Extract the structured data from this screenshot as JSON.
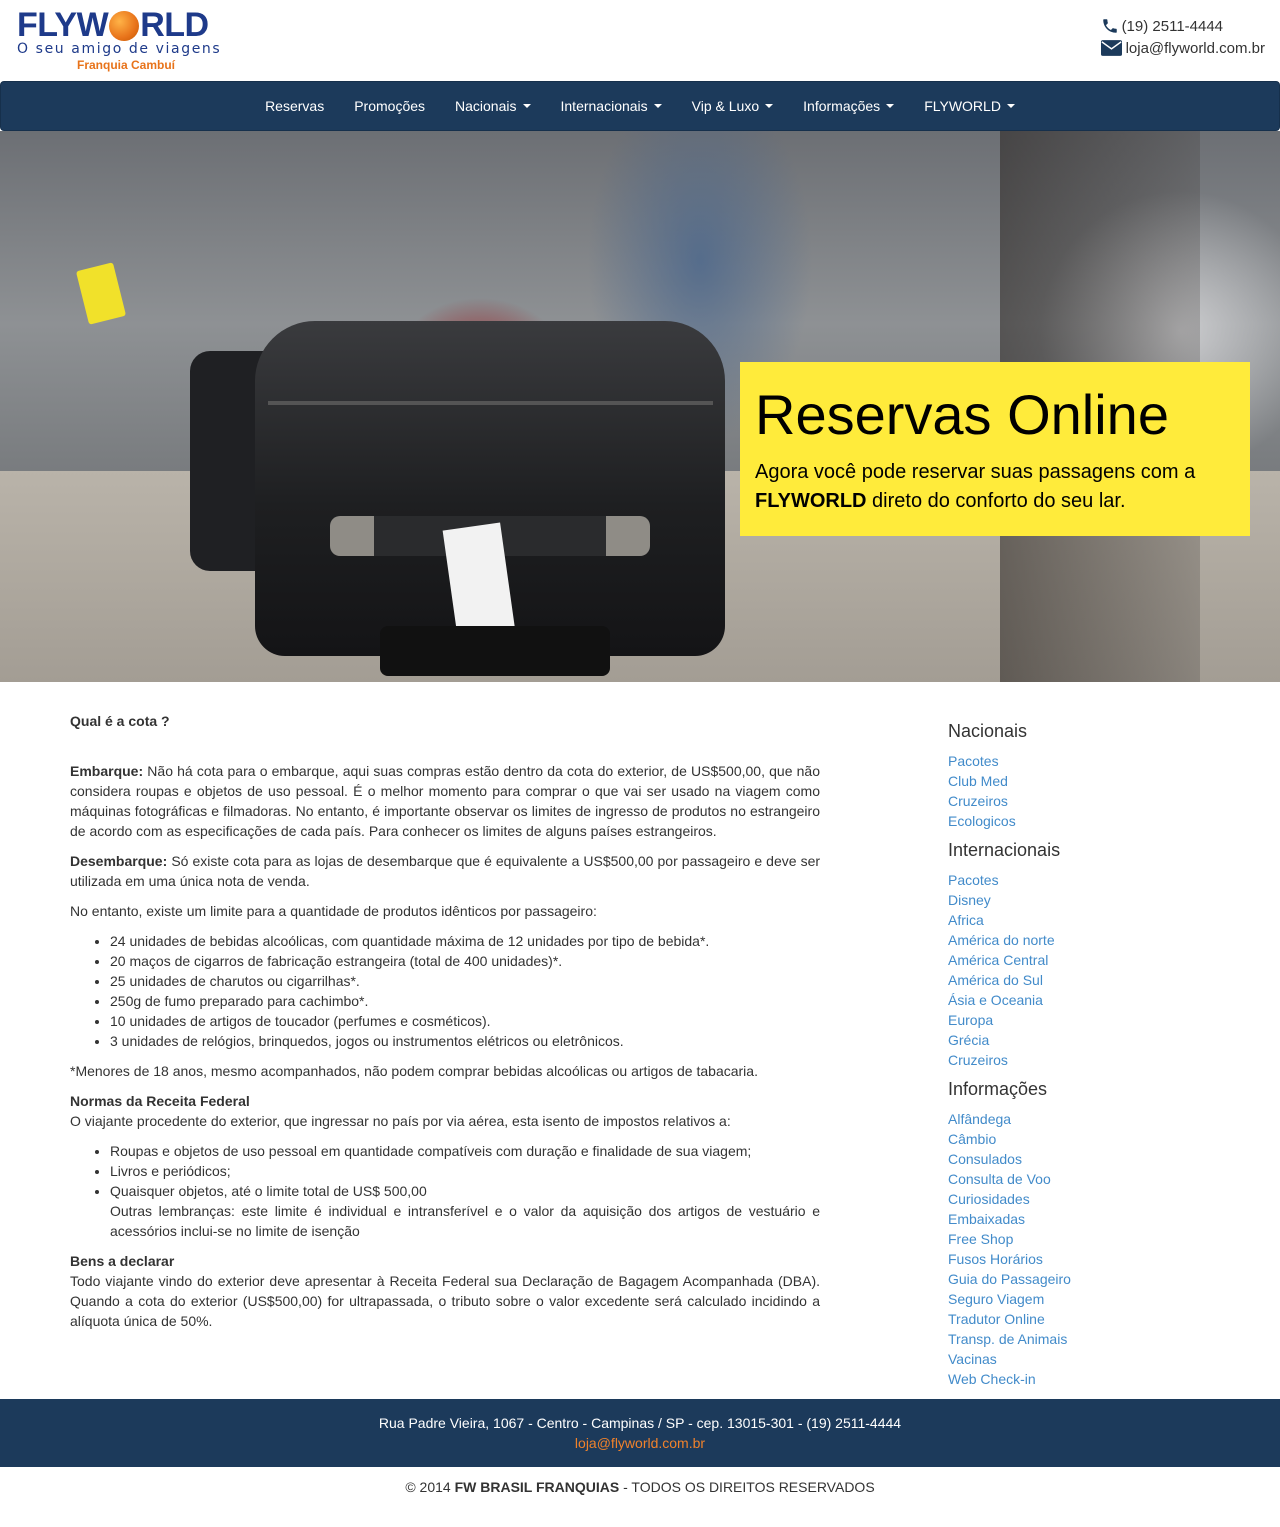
{
  "header": {
    "logo_name": "FLYWORLD",
    "logo_prefix": "FLYW",
    "logo_suffix": "RLD",
    "logo_tagline": "O seu amigo de viagens",
    "logo_franchise": "Franquia Cambuí",
    "phone": "(19) 2511-4444",
    "email": "loja@flyworld.com.br",
    "icons": {
      "phone": "phone-icon",
      "email": "envelope-icon"
    }
  },
  "nav": {
    "items": [
      {
        "label": "Reservas",
        "dropdown": false
      },
      {
        "label": "Promoções",
        "dropdown": false
      },
      {
        "label": "Nacionais",
        "dropdown": true
      },
      {
        "label": "Internacionais",
        "dropdown": true
      },
      {
        "label": "Vip & Luxo",
        "dropdown": true
      },
      {
        "label": "Informações",
        "dropdown": true
      },
      {
        "label": "FLYWORLD",
        "dropdown": true
      }
    ]
  },
  "hero": {
    "title": "Reservas Online",
    "text_before": "Agora você pode reservar suas passagens com a",
    "text_brand": "FLYWORLD",
    "text_after": "direto do conforto do seu lar."
  },
  "content": {
    "heading": "Qual é a cota ?",
    "embarque_label": "Embarque:",
    "embarque_text": "Não há cota para o embarque, aqui suas compras estão dentro da cota do exterior, de US$500,00, que não considera roupas e objetos de uso pessoal. É o melhor momento para comprar o que vai ser usado na viagem como máquinas fotográficas e filmadoras. No entanto, é importante observar os limites de ingresso de produtos no estrangeiro de acordo com as especificações de cada país. Para conhecer os limites de alguns países estrangeiros.",
    "desembarque_label": "Desembarque:",
    "desembarque_text": "Só existe cota para as lojas de desembarque que é equivalente a US$500,00 por passageiro e deve ser utilizada em uma única nota de venda.",
    "limit_intro": "No entanto, existe um limite para a quantidade de produtos idênticos por passageiro:",
    "limits": [
      "24 unidades de bebidas alcoólicas, com quantidade máxima de 12 unidades por tipo de bebida*.",
      "20 maços de cigarros de fabricação estrangeira (total de 400 unidades)*.",
      "25 unidades de charutos ou cigarrilhas*.",
      "250g de fumo preparado para cachimbo*.",
      "10 unidades de artigos de toucador (perfumes e cosméticos).",
      "3 unidades de relógios, brinquedos, jogos ou instrumentos elétricos ou eletrônicos."
    ],
    "minors_note": "*Menores de 18 anos, mesmo acompanhados, não podem comprar bebidas alcoólicas ou artigos de tabacaria.",
    "normas_heading": "Normas da Receita Federal",
    "normas_text": "O viajante procedente do exterior, que ingressar no país por via aérea, esta isento de impostos relativos a:",
    "normas_items": [
      "Roupas e objetos de uso pessoal em quantidade compatíveis com duração e finalidade de sua viagem;",
      "Livros e periódicos;",
      "Quaisquer objetos, até o limite total de US$ 500,00"
    ],
    "normas_extra": "Outras lembranças: este limite é individual e intransferível e o valor da aquisição dos artigos de vestuário e acessórios inclui-se no limite de isenção",
    "bens_heading": "Bens a declarar",
    "bens_text": "Todo viajante vindo do exterior deve apresentar à Receita Federal sua Declaração de Bagagem Acompanhada (DBA). Quando a cota do exterior (US$500,00) for ultrapassada, o tributo sobre o valor excedente será calculado incidindo a alíquota única de 50%."
  },
  "sidebar": {
    "nacionais": {
      "title": "Nacionais",
      "links": [
        "Pacotes",
        "Club Med",
        "Cruzeiros",
        "Ecologicos"
      ]
    },
    "internacionais": {
      "title": "Internacionais",
      "links": [
        "Pacotes",
        "Disney",
        "Africa",
        "América do norte",
        "América Central",
        "América do Sul",
        "Ásia e Oceania",
        "Europa",
        "Grécia",
        "Cruzeiros"
      ]
    },
    "informacoes": {
      "title": "Informações",
      "links": [
        "Alfândega",
        "Câmbio",
        "Consulados",
        "Consulta de Voo",
        "Curiosidades",
        "Embaixadas",
        "Free Shop",
        "Fusos Horários",
        "Guia do Passageiro",
        "Seguro Viagem",
        "Tradutor Online",
        "Transp. de Animais",
        "Vacinas",
        "Web Check-in"
      ]
    }
  },
  "footer": {
    "address": "Rua Padre Vieira, 1067 - Centro - Campinas / SP - cep. 13015-301 - (19) 2511-4444",
    "email": "loja@flyworld.com.br",
    "copyright_prefix": "© 2014",
    "copyright_brand": "FW BRASIL FRANQUIAS",
    "copyright_suffix": "- TODOS OS DIREITOS RESERVADOS"
  },
  "colors": {
    "navbar": "#1c3a5b",
    "promo_box": "#ffeb3b",
    "link": "#428bca",
    "footer_email": "#f0822b",
    "logo_blue": "#1e3a8a",
    "logo_orange": "#e8731a"
  }
}
